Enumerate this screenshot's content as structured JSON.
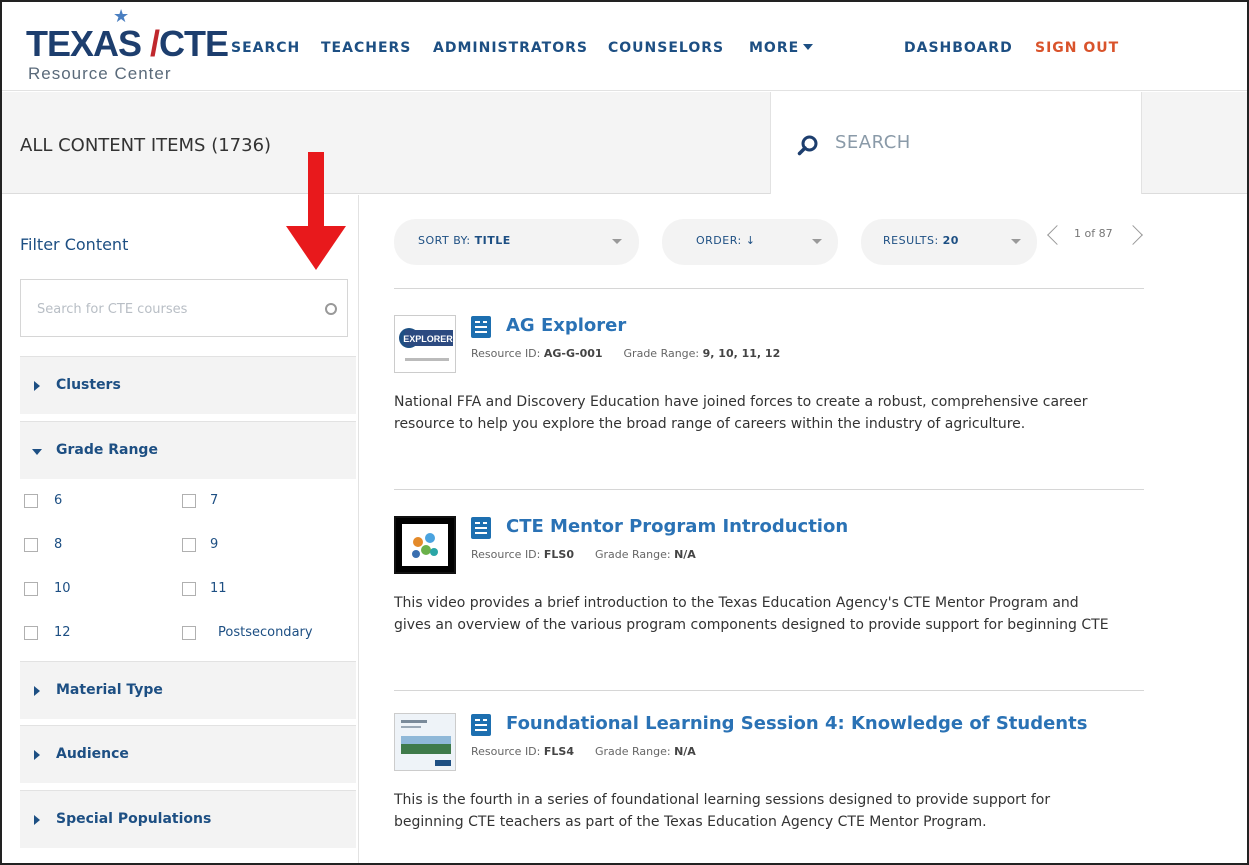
{
  "header": {
    "logo": {
      "brand_left": "TEXAS",
      "brand_right": "CTE",
      "subtitle": "Resource Center"
    },
    "nav": {
      "search": "SEARCH",
      "teachers": "TEACHERS",
      "administrators": "ADMINISTRATORS",
      "counselors": "COUNSELORS",
      "more": "MORE",
      "dashboard": "DASHBOARD",
      "sign_out": "SIGN OUT"
    }
  },
  "titlebar": {
    "title": "ALL CONTENT ITEMS (1736)",
    "search_label": "SEARCH"
  },
  "sidebar": {
    "filter_title": "Filter Content",
    "search_placeholder": "Search for CTE courses",
    "sections": {
      "clusters": "Clusters",
      "grade_range": "Grade Range",
      "material_type": "Material Type",
      "audience": "Audience",
      "special_populations": "Special Populations"
    },
    "grades": [
      "6",
      "7",
      "8",
      "9",
      "10",
      "11",
      "12",
      "Postsecondary"
    ]
  },
  "controls": {
    "sort_by_label": "SORT BY:",
    "sort_by_value": "TITLE",
    "order_label": "ORDER:",
    "order_value": "↓",
    "results_label": "RESULTS:",
    "results_value": "20",
    "pager_text": "1 of 87"
  },
  "items": [
    {
      "title": "AG Explorer",
      "resource_id_label": "Resource ID:",
      "resource_id": "AG-G-001",
      "grade_range_label": "Grade Range:",
      "grade_range": "9, 10, 11, 12",
      "thumb_text": "EXPLORER",
      "description": "National FFA and Discovery Education have joined forces to create a robust, comprehensive career resource to help you explore the broad range of careers within the industry of agriculture."
    },
    {
      "title": "CTE Mentor Program Introduction",
      "resource_id_label": "Resource ID:",
      "resource_id": "FLS0",
      "grade_range_label": "Grade Range:",
      "grade_range": "N/A",
      "description": "This video provides a brief introduction to the Texas Education Agency's CTE Mentor Program and gives an overview of the various program components designed to provide support for beginning CTE"
    },
    {
      "title": "Foundational Learning Session 4: Knowledge of Students",
      "resource_id_label": "Resource ID:",
      "resource_id": "FLS4",
      "grade_range_label": "Grade Range:",
      "grade_range": "N/A",
      "description": "This is the fourth in a series of foundational learning sessions designed to provide support for beginning CTE teachers as part of the Texas Education Agency CTE Mentor Program."
    }
  ],
  "colors": {
    "brand_navy": "#1d3e6e",
    "link_blue": "#1d4f83",
    "title_blue": "#2a72b5",
    "sign_out_orange": "#d9532b",
    "annotation_red": "#e8191c"
  }
}
